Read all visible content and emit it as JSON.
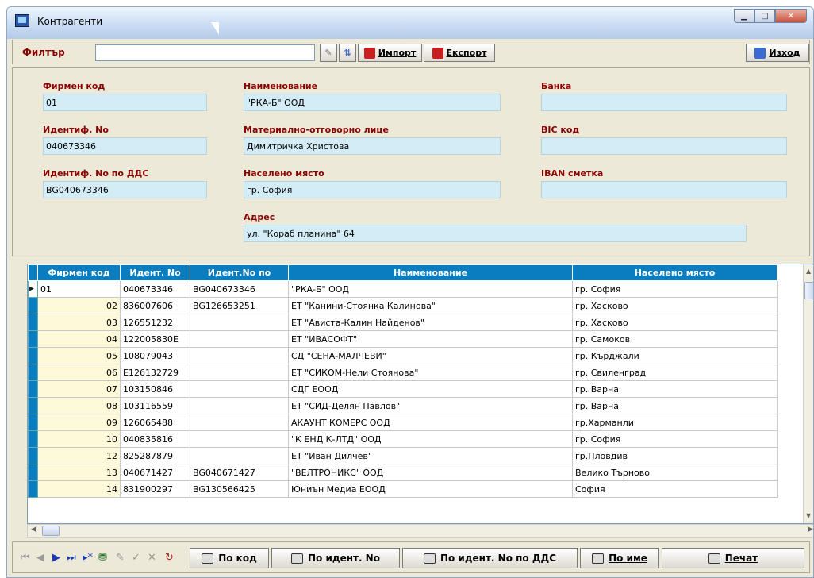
{
  "window": {
    "title": "Контрагенти"
  },
  "toolbar": {
    "filter_label": "Филтър",
    "filter_value": "",
    "import_label": "Импорт",
    "export_label": "Експорт",
    "exit_label": "Изход"
  },
  "detail": {
    "code_label": "Фирмен код",
    "code_value": "01",
    "id_label": "Идентиф. No",
    "id_value": "040673346",
    "vat_label": "Идентиф. No по ДДС",
    "vat_value": "BG040673346",
    "name_label": "Наименование",
    "name_value": "\"РКА-Б\" ООД",
    "mol_label": "Материално-отговорно лице",
    "mol_value": "Димитричка Христова",
    "city_label": "Населено място",
    "city_value": "гр. София",
    "address_label": "Адрес",
    "address_value": "ул. \"Кораб планина\" 64",
    "bank_label": "Банка",
    "bank_value": "",
    "bic_label": "BIC код",
    "bic_value": "",
    "iban_label": "IBAN сметка",
    "iban_value": ""
  },
  "grid": {
    "headers": [
      "Фирмен код",
      "Идент. No",
      "Идент.No по",
      "Наименование",
      "Населено място"
    ],
    "rows": [
      [
        "01",
        "040673346",
        "BG040673346",
        "\"РКА-Б\" ООД",
        "гр. София"
      ],
      [
        "02",
        "836007606",
        "BG126653251",
        "ЕТ \"Канини-Стоянка Калинова\"",
        "гр. Хасково"
      ],
      [
        "03",
        "126551232",
        "",
        "ЕТ \"Ависта-Калин Найденов\"",
        "гр. Хасково"
      ],
      [
        "04",
        "122005830E",
        "",
        "ЕТ \"ИВАСОФТ\"",
        "гр. Самоков"
      ],
      [
        "05",
        "108079043",
        "",
        "СД \"СЕНА-МАЛЧЕВИ\"",
        "гр. Кърджали"
      ],
      [
        "06",
        "E126132729",
        "",
        "ЕТ \"СИКОМ-Нели Стоянова\"",
        "гр. Свиленград"
      ],
      [
        "07",
        "103150846",
        "",
        "СДГ ЕООД",
        "гр. Варна"
      ],
      [
        "08",
        "103116559",
        "",
        "ЕТ \"СИД-Делян Павлов\"",
        "гр. Варна"
      ],
      [
        "09",
        "126065488",
        "",
        "АКАУНТ КОМЕРС ООД",
        "гр.Харманли"
      ],
      [
        "10",
        "040835816",
        "",
        "\"К ЕНД К-ЛТД\" ООД",
        "гр. София"
      ],
      [
        "12",
        "825287879",
        "",
        "ЕТ \"Иван Дилчев\"",
        "гр.Пловдив"
      ],
      [
        "13",
        "040671427",
        "BG040671427",
        "\"ВЕЛТРОНИКС\" ООД",
        "Велико Търново"
      ],
      [
        "14",
        "831900297",
        "BG130566425",
        "Юниън Медиа ЕООД",
        "София"
      ]
    ]
  },
  "bottom": {
    "by_code": "По код",
    "by_id": "По идент. No",
    "by_vat": "По идент. No по ДДС",
    "by_name": "По име",
    "print": "Печат"
  }
}
